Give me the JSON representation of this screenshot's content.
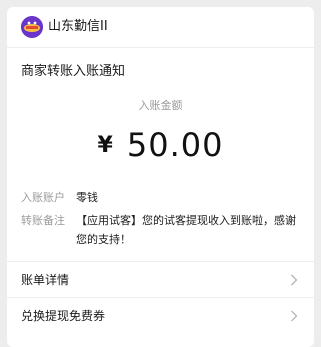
{
  "header": {
    "avatar_icon": "app-logo-icon",
    "app_name": "山东勤信II"
  },
  "notice": {
    "title": "商家转账入账通知",
    "amount_label": "入账金额",
    "currency": "¥",
    "amount": "50.00"
  },
  "details": {
    "account_key": "入账账户",
    "account_value": "零钱",
    "remark_key": "转账备注",
    "remark_value": "【应用试客】您的试客提现收入到账啦，感谢您的支持！"
  },
  "actions": [
    {
      "label": "账单详情",
      "icon": "chevron-right-icon"
    },
    {
      "label": "兑换提现免费券",
      "icon": "chevron-right-icon"
    }
  ],
  "colors": {
    "background": "#ededed",
    "card": "#ffffff",
    "avatar": "#6a35c9",
    "muted_text": "#9a9a9a"
  }
}
